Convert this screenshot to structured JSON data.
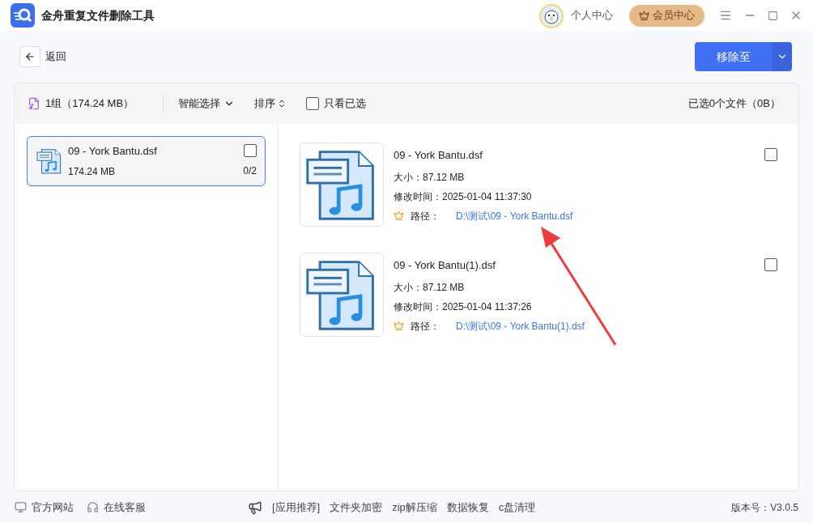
{
  "window": {
    "title": "金舟重复文件删除工具",
    "user_center": "个人中心",
    "vip_center": "会员中心"
  },
  "back": {
    "label": "返回"
  },
  "action": {
    "label": "移除至"
  },
  "toolbar": {
    "group_summary": "1组（174.24 MB）",
    "smart_select": "智能选择",
    "sort": "排序",
    "only_selected": {
      "label": "只看已选",
      "checked": false
    },
    "selected_summary": "已选0个文件（0B）"
  },
  "groups": [
    {
      "name": "09 - York Bantu.dsf",
      "size": "174.24 MB",
      "count": "0/2",
      "selected": true,
      "checked": false
    }
  ],
  "files": [
    {
      "name": "09 - York Bantu.dsf",
      "size_label": "大小：",
      "size": "87.12 MB",
      "time_label": "修改时间：",
      "time": "2025-01-04 11:37:30",
      "path_label": "路径：",
      "path": "D:\\测试\\09 - York Bantu.dsf",
      "checked": false
    },
    {
      "name": "09 - York Bantu(1).dsf",
      "size_label": "大小：",
      "size": "87.12 MB",
      "time_label": "修改时间：",
      "time": "2025-01-04 11:37:26",
      "path_label": "路径：",
      "path": "D:\\测试\\09 - York Bantu(1).dsf",
      "checked": false
    }
  ],
  "footer": {
    "links": [
      "官方网站",
      "在线客服"
    ],
    "promo": [
      "[应用推荐]",
      "文件夹加密",
      "zip解压缩",
      "数据恢复",
      "c盘清理"
    ],
    "version": "版本号：V3.0.5"
  }
}
